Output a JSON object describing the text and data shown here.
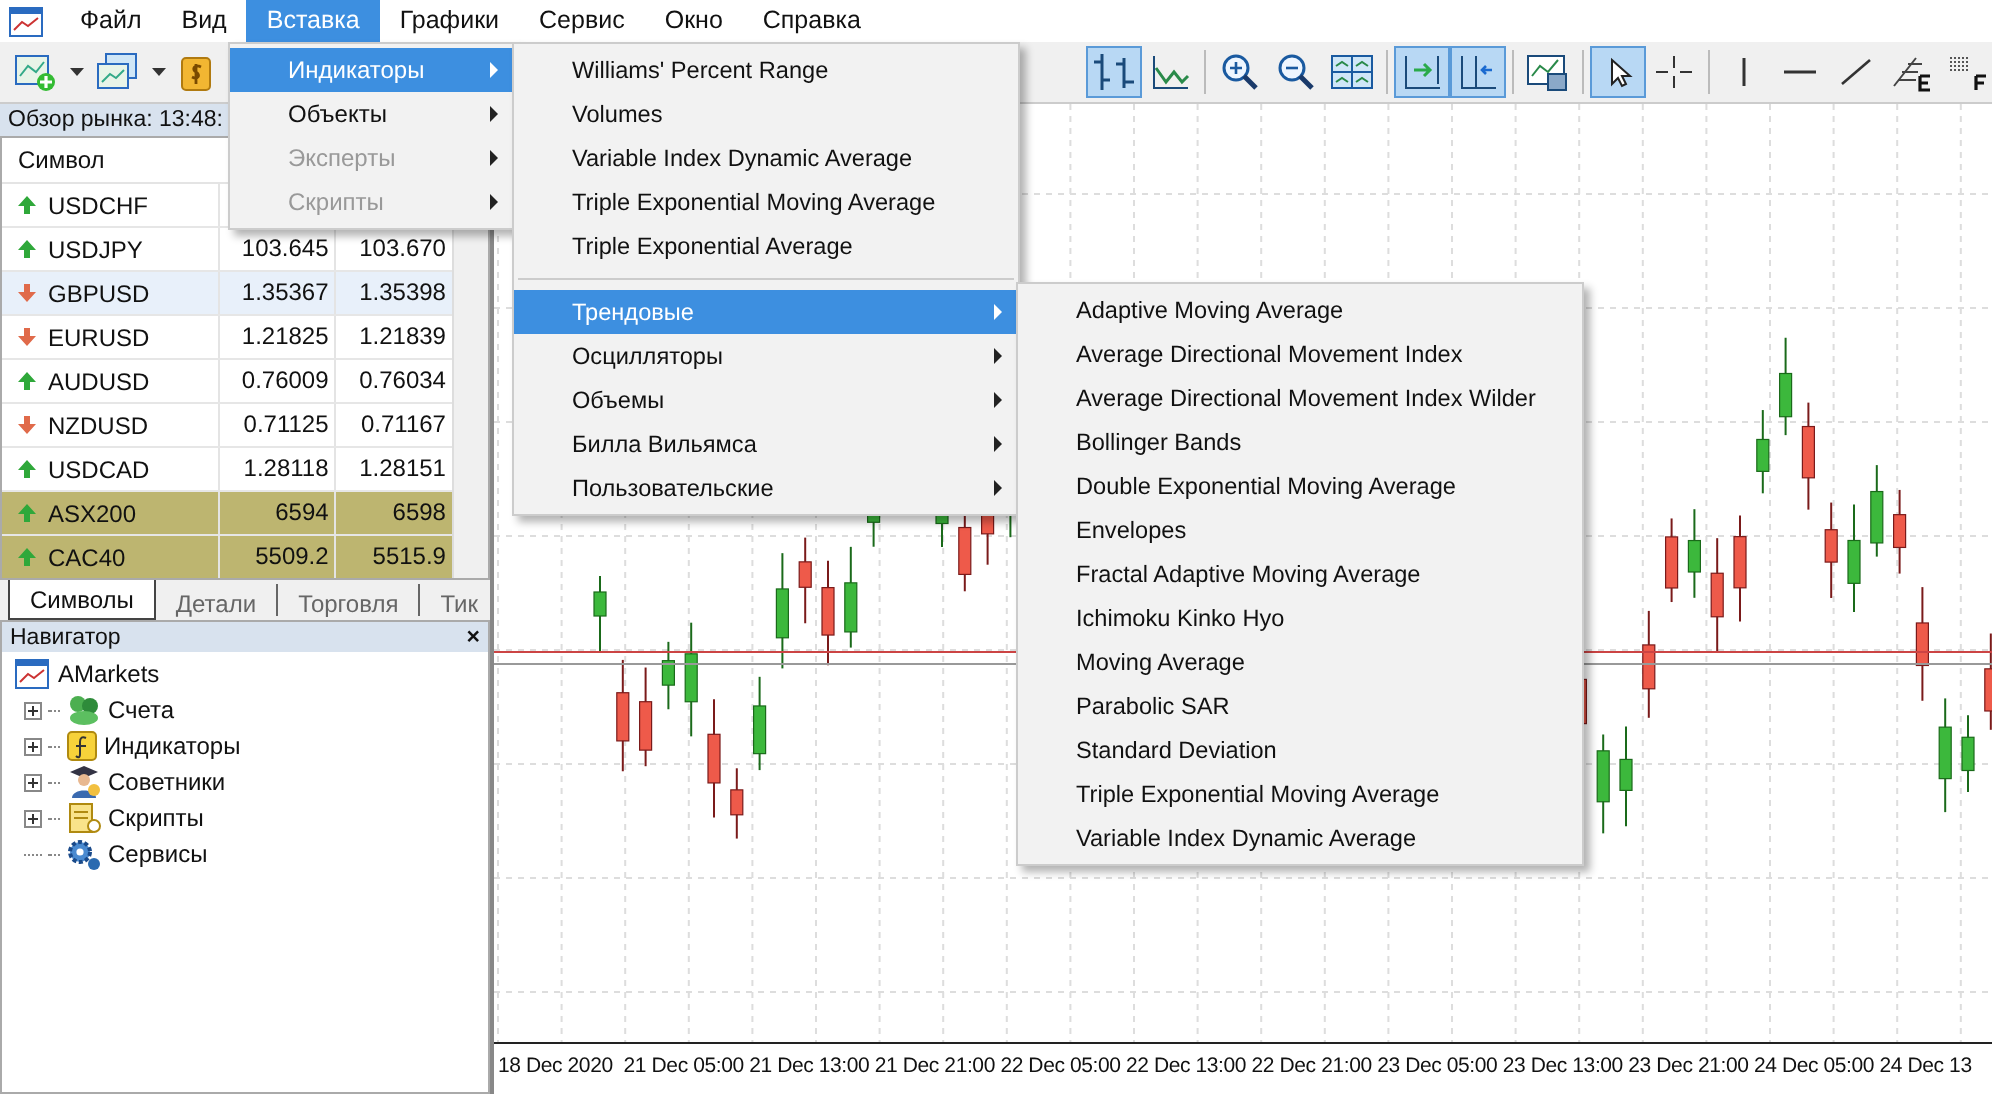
{
  "menubar": [
    {
      "label": "Файл",
      "selected": false
    },
    {
      "label": "Вид",
      "selected": false
    },
    {
      "label": "Вставка",
      "selected": true
    },
    {
      "label": "Графики",
      "selected": false
    },
    {
      "label": "Сервис",
      "selected": false
    },
    {
      "label": "Окно",
      "selected": false
    },
    {
      "label": "Справка",
      "selected": false
    }
  ],
  "toolbar": {
    "left": [
      {
        "kind": "new-chart",
        "pressed": false,
        "dropdown": true
      },
      {
        "kind": "profiles",
        "pressed": false,
        "dropdown": true
      },
      {
        "kind": "dollar",
        "pressed": false,
        "dropdown": false
      }
    ],
    "right": [
      {
        "kind": "bar-chart",
        "pressed": true
      },
      {
        "kind": "line-chart",
        "pressed": false
      },
      {
        "kind": "separator"
      },
      {
        "kind": "zoom-in",
        "pressed": false
      },
      {
        "kind": "zoom-out",
        "pressed": false
      },
      {
        "kind": "tile",
        "pressed": false
      },
      {
        "kind": "separator"
      },
      {
        "kind": "autoscroll",
        "pressed": true
      },
      {
        "kind": "shift",
        "pressed": true
      },
      {
        "kind": "separator"
      },
      {
        "kind": "template",
        "pressed": false
      },
      {
        "kind": "separator"
      },
      {
        "kind": "cursor",
        "pressed": true
      },
      {
        "kind": "crosshair",
        "pressed": false
      },
      {
        "kind": "separator"
      },
      {
        "kind": "vline",
        "pressed": false
      },
      {
        "kind": "hline",
        "pressed": false
      },
      {
        "kind": "trendline",
        "pressed": false
      },
      {
        "kind": "fibo",
        "pressed": false
      },
      {
        "kind": "grid",
        "pressed": false
      }
    ]
  },
  "market_watch": {
    "title": "Обзор рынка: 13:48:",
    "columns": [
      "Символ"
    ],
    "rows": [
      {
        "symbol": "USDCHF",
        "kind": "up",
        "highlighted": false,
        "selected": false
      },
      {
        "symbol": "USDJPY",
        "bid": "103.645",
        "ask": "103.670",
        "kind": "up",
        "highlighted": false,
        "selected": false
      },
      {
        "symbol": "GBPUSD",
        "bid": "1.35367",
        "ask": "1.35398",
        "kind": "down",
        "highlighted": false,
        "selected": true
      },
      {
        "symbol": "EURUSD",
        "bid": "1.21825",
        "ask": "1.21839",
        "kind": "down",
        "highlighted": false,
        "selected": false
      },
      {
        "symbol": "AUDUSD",
        "bid": "0.76009",
        "ask": "0.76034",
        "kind": "up",
        "highlighted": false,
        "selected": false
      },
      {
        "symbol": "NZDUSD",
        "bid": "0.71125",
        "ask": "0.71167",
        "kind": "down",
        "highlighted": false,
        "selected": false
      },
      {
        "symbol": "USDCAD",
        "bid": "1.28118",
        "ask": "1.28151",
        "kind": "up",
        "highlighted": false,
        "selected": false
      },
      {
        "symbol": "ASX200",
        "bid": "6594",
        "ask": "6598",
        "kind": "up",
        "highlighted": true,
        "selected": false
      },
      {
        "symbol": "CAC40",
        "bid": "5509.2",
        "ask": "5515.9",
        "kind": "up",
        "highlighted": true,
        "selected": false
      }
    ],
    "tabs": [
      {
        "label": "Символы",
        "selected": true
      },
      {
        "label": "Детали",
        "selected": false
      },
      {
        "label": "Торговля",
        "selected": false
      },
      {
        "label": "Тик",
        "selected": false
      }
    ]
  },
  "navigator": {
    "title": "Навигатор",
    "close": "×",
    "root": {
      "label": "AMarkets",
      "children": [
        {
          "label": "Счета",
          "kind": "accounts",
          "expandable": true
        },
        {
          "label": "Индикаторы",
          "kind": "indicators",
          "expandable": true
        },
        {
          "label": "Советники",
          "kind": "experts",
          "expandable": true
        },
        {
          "label": "Скрипты",
          "kind": "scripts",
          "expandable": true
        },
        {
          "label": "Сервисы",
          "kind": "services",
          "expandable": false
        }
      ]
    }
  },
  "insert_menu": [
    {
      "label": "Индикаторы",
      "selected": true,
      "disabled": false
    },
    {
      "label": "Объекты",
      "selected": false,
      "disabled": false
    },
    {
      "label": "Эксперты",
      "selected": false,
      "disabled": true
    },
    {
      "label": "Скрипты",
      "selected": false,
      "disabled": true
    }
  ],
  "indicators_menu": [
    {
      "kind": "item",
      "label": "Williams' Percent Range",
      "selected": false
    },
    {
      "kind": "item",
      "label": "Volumes",
      "selected": false
    },
    {
      "kind": "item",
      "label": "Variable Index Dynamic Average",
      "selected": false
    },
    {
      "kind": "item",
      "label": "Triple Exponential Moving Average",
      "selected": false
    },
    {
      "kind": "item",
      "label": "Triple Exponential Average",
      "selected": false
    },
    {
      "kind": "separator"
    },
    {
      "kind": "submenu",
      "label": "Трендовые",
      "selected": true
    },
    {
      "kind": "submenu",
      "label": "Осцилляторы",
      "selected": false
    },
    {
      "kind": "submenu",
      "label": "Объемы",
      "selected": false
    },
    {
      "kind": "submenu",
      "label": "Билла Вильямса",
      "selected": false
    },
    {
      "kind": "submenu",
      "label": "Пользовательские",
      "selected": false
    }
  ],
  "trend_menu": [
    "Adaptive Moving Average",
    "Average Directional Movement Index",
    "Average Directional Movement Index Wilder",
    "Bollinger Bands",
    "Double Exponential Moving Average",
    "Envelopes",
    "Fractal Adaptive Moving Average",
    "Ichimoku Kinko Hyo",
    "Moving Average",
    "Parabolic SAR",
    "Standard Deviation",
    "Triple Exponential Moving Average",
    "Variable Index Dynamic Average"
  ],
  "chart": {
    "time_axis": [
      "18 Dec 2020",
      "21 Dec 05:00",
      "21 Dec 13:00",
      "21 Dec 21:00",
      "22 Dec 05:00",
      "22 Dec 13:00",
      "22 Dec 21:00",
      "23 Dec 05:00",
      "23 Dec 13:00",
      "23 Dec 21:00",
      "24 Dec 05:00",
      "24 Dec 13"
    ]
  }
}
